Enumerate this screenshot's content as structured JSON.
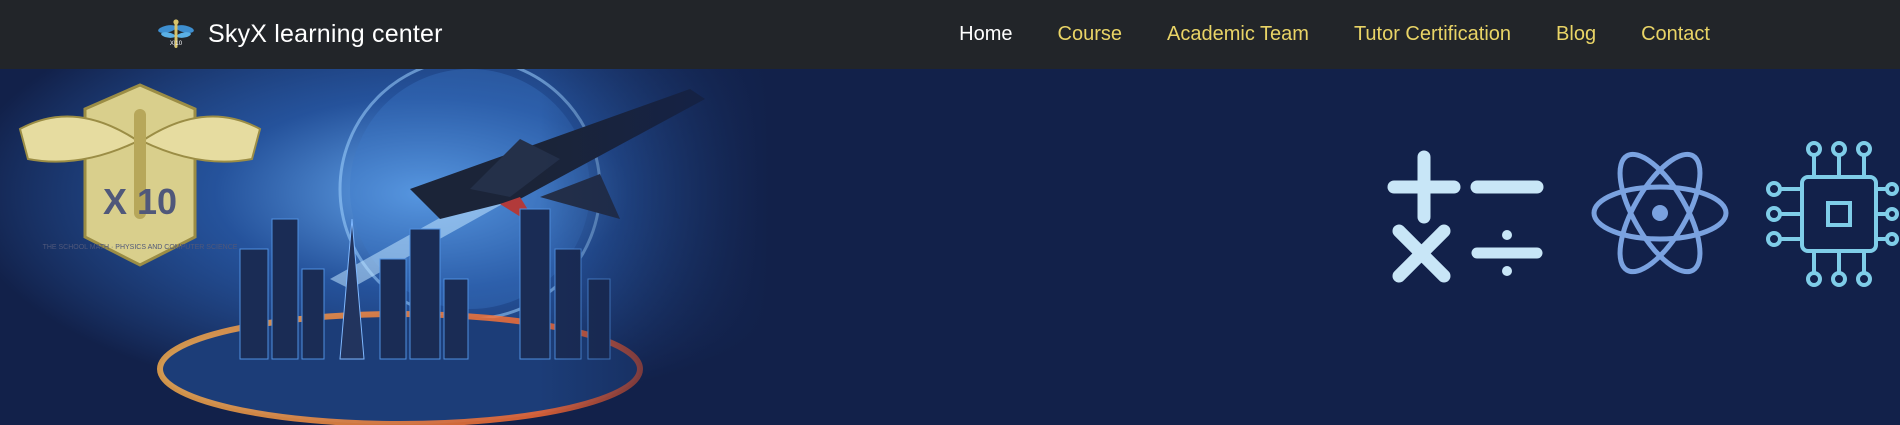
{
  "brand": {
    "name": "SkyX learning center",
    "logo_icon": "dragonfly-x10-logo-icon",
    "emblem_text": "X 10",
    "emblem_motto": "THE SCHOOL MATH · PHYSICS AND COMPUTER SCIENCE"
  },
  "nav": {
    "items": [
      {
        "label": "Home",
        "active": true
      },
      {
        "label": "Course",
        "active": false
      },
      {
        "label": "Academic Team",
        "active": false
      },
      {
        "label": "Tutor Certification",
        "active": false
      },
      {
        "label": "Blog",
        "active": false
      },
      {
        "label": "Contact",
        "active": false
      }
    ]
  },
  "hero": {
    "banner_icon": "city-jet-banner-image",
    "subject_icons": [
      "math-operators-icon",
      "atom-icon",
      "circuit-chip-icon"
    ]
  },
  "colors": {
    "navbar_bg": "#222529",
    "nav_link": "#e9d466",
    "nav_active": "#ffffff",
    "hero_bg": "#12214a",
    "math_icon": "#c8e6f7",
    "atom_icon": "#7aa2e0",
    "chip_icon": "#7fcde8"
  }
}
